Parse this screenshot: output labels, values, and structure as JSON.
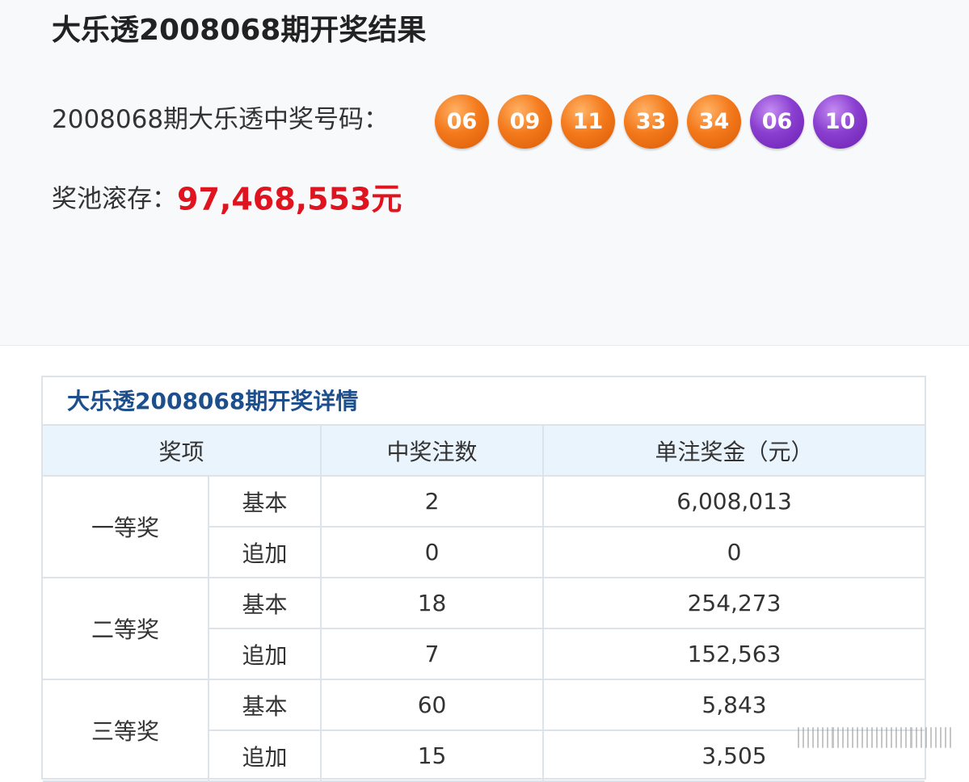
{
  "header": {
    "title": "大乐透2008068期开奖结果",
    "draw_label": "2008068期大乐透中奖号码："
  },
  "balls": [
    {
      "number": "06",
      "color": "red"
    },
    {
      "number": "09",
      "color": "red"
    },
    {
      "number": "11",
      "color": "red"
    },
    {
      "number": "33",
      "color": "red"
    },
    {
      "number": "34",
      "color": "red"
    },
    {
      "number": "06",
      "color": "blue"
    },
    {
      "number": "10",
      "color": "blue"
    }
  ],
  "pool": {
    "label": "奖池滚存：",
    "value": "97,468,553元",
    "color": "#e0141e"
  },
  "detail": {
    "title": "大乐透2008068期开奖详情",
    "headers": [
      "奖项",
      "中奖注数",
      "单注奖金（元）"
    ],
    "rows": [
      {
        "level": "一等奖",
        "items": [
          {
            "type": "基本",
            "count": "2",
            "amount": "6,008,013"
          },
          {
            "type": "追加",
            "count": "0",
            "amount": "0"
          }
        ]
      },
      {
        "level": "二等奖",
        "items": [
          {
            "type": "基本",
            "count": "18",
            "amount": "254,273"
          },
          {
            "type": "追加",
            "count": "7",
            "amount": "152,563"
          }
        ]
      },
      {
        "level": "三等奖",
        "items": [
          {
            "type": "基本",
            "count": "60",
            "amount": "5,843"
          },
          {
            "type": "追加",
            "count": "15",
            "amount": "3,505"
          }
        ]
      }
    ]
  },
  "colors": {
    "ball_red": "#f47a1c",
    "ball_blue": "#8a3fd0",
    "title_blue": "#1d4f8c",
    "header_bg": "#e9f4fd"
  }
}
